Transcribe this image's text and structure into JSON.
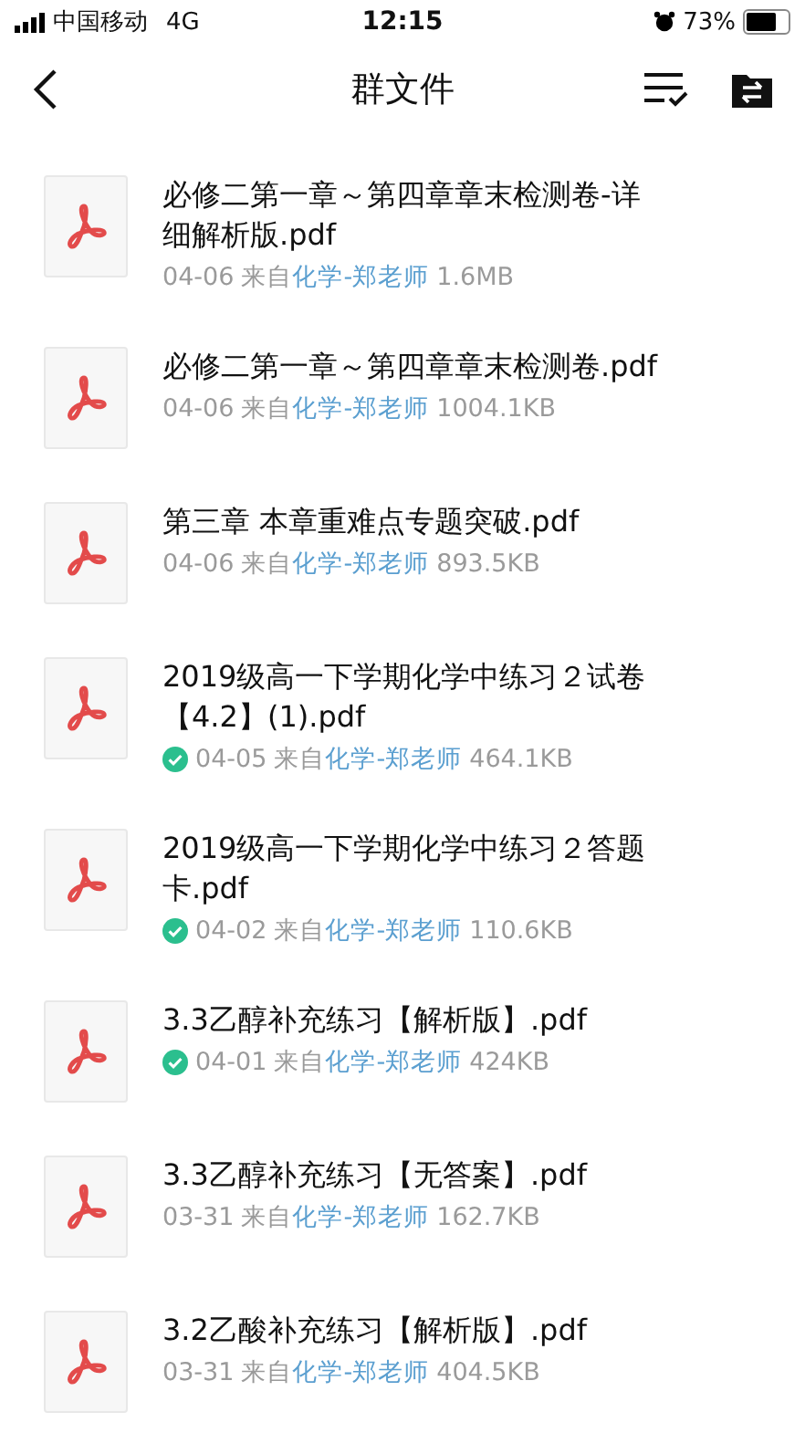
{
  "status_bar": {
    "carrier": "中国移动",
    "network": "4G",
    "time": "12:15",
    "battery": "73%"
  },
  "nav": {
    "title": "群文件"
  },
  "files": [
    {
      "name": "必修二第一章～第四章章末检测卷-详细解析版.pdf",
      "downloaded": false,
      "date": "04-06",
      "from": "来自",
      "sender": "化学-郑老师",
      "size": "1.6MB"
    },
    {
      "name": "必修二第一章～第四章章末检测卷.pdf",
      "downloaded": false,
      "date": "04-06",
      "from": "来自",
      "sender": "化学-郑老师",
      "size": "1004.1KB"
    },
    {
      "name": "第三章  本章重难点专题突破.pdf",
      "downloaded": false,
      "date": "04-06",
      "from": "来自",
      "sender": "化学-郑老师",
      "size": "893.5KB"
    },
    {
      "name": "2019级高一下学期化学中练习２试卷【4.2】(1).pdf",
      "downloaded": true,
      "date": "04-05",
      "from": "来自",
      "sender": "化学-郑老师",
      "size": "464.1KB"
    },
    {
      "name": "2019级高一下学期化学中练习２答题卡.pdf",
      "downloaded": true,
      "date": "04-02",
      "from": "来自",
      "sender": "化学-郑老师",
      "size": "110.6KB"
    },
    {
      "name": "3.3乙醇补充练习【解析版】.pdf",
      "downloaded": true,
      "date": "04-01",
      "from": "来自",
      "sender": "化学-郑老师",
      "size": "424KB"
    },
    {
      "name": "3.3乙醇补充练习【无答案】.pdf",
      "downloaded": false,
      "date": "03-31",
      "from": "来自",
      "sender": "化学-郑老师",
      "size": "162.7KB"
    },
    {
      "name": "3.2乙酸补充练习【解析版】.pdf",
      "downloaded": false,
      "date": "03-31",
      "from": "来自",
      "sender": "化学-郑老师",
      "size": "404.5KB"
    }
  ]
}
